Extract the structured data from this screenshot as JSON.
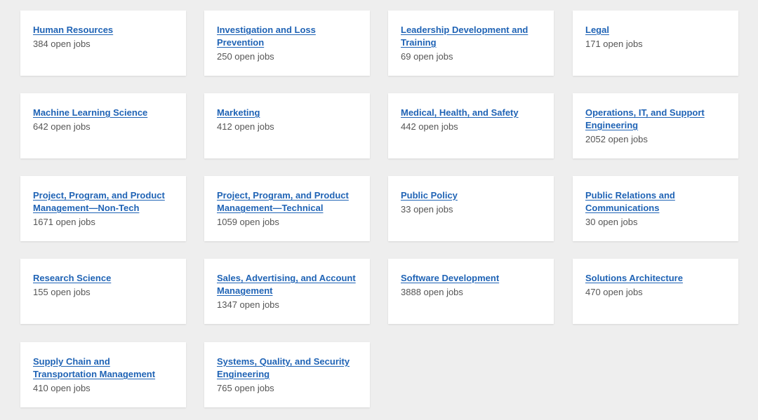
{
  "job_categories": [
    {
      "title": "Human Resources",
      "count": "384 open jobs"
    },
    {
      "title": "Investigation and Loss Prevention",
      "count": "250 open jobs"
    },
    {
      "title": "Leadership Development and Training",
      "count": "69 open jobs"
    },
    {
      "title": "Legal",
      "count": "171 open jobs"
    },
    {
      "title": "Machine Learning Science",
      "count": "642 open jobs"
    },
    {
      "title": "Marketing",
      "count": "412 open jobs"
    },
    {
      "title": "Medical, Health, and Safety",
      "count": "442 open jobs"
    },
    {
      "title": "Operations, IT, and Support Engineering",
      "count": "2052 open jobs"
    },
    {
      "title": "Project, Program, and Product Management—Non-Tech",
      "count": "1671 open jobs"
    },
    {
      "title": "Project, Program, and Product Management—Technical",
      "count": "1059 open jobs"
    },
    {
      "title": "Public Policy",
      "count": "33 open jobs"
    },
    {
      "title": "Public Relations and Communications",
      "count": "30 open jobs"
    },
    {
      "title": "Research Science",
      "count": "155 open jobs"
    },
    {
      "title": "Sales, Advertising, and Account Management",
      "count": "1347 open jobs"
    },
    {
      "title": "Software Development",
      "count": "3888 open jobs"
    },
    {
      "title": "Solutions Architecture",
      "count": "470 open jobs"
    },
    {
      "title": "Supply Chain and Transportation Management",
      "count": "410 open jobs"
    },
    {
      "title": "Systems, Quality, and Security Engineering",
      "count": "765 open jobs"
    }
  ]
}
